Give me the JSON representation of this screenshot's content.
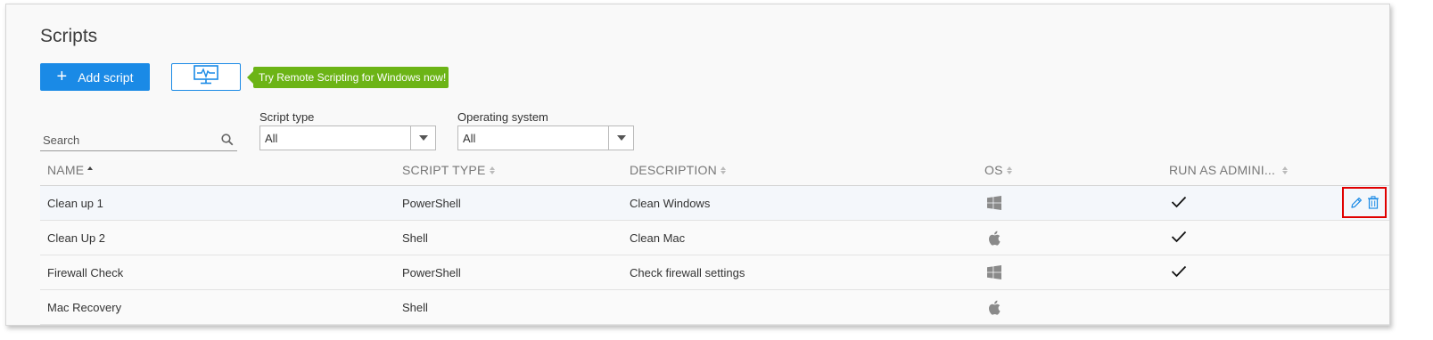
{
  "page": {
    "title": "Scripts"
  },
  "toolbar": {
    "add_label": "Add script",
    "add_icon": "plus-icon",
    "remote_icon": "monitor-pulse-icon",
    "promo_text": "Try Remote Scripting for Windows now!"
  },
  "filters": {
    "search_placeholder": "Search",
    "script_type_label": "Script type",
    "script_type_value": "All",
    "os_label": "Operating system",
    "os_value": "All"
  },
  "table": {
    "columns": [
      "NAME",
      "SCRIPT TYPE",
      "DESCRIPTION",
      "OS",
      "RUN AS ADMINI..."
    ],
    "rows": [
      {
        "name": "Clean up 1",
        "script_type": "PowerShell",
        "description": "Clean Windows",
        "os": "windows-icon",
        "run_as_admin": true
      },
      {
        "name": "Clean Up 2",
        "script_type": "Shell",
        "description": "Clean Mac",
        "os": "apple-icon",
        "run_as_admin": true
      },
      {
        "name": "Firewall Check",
        "script_type": "PowerShell",
        "description": "Check firewall settings",
        "os": "windows-icon",
        "run_as_admin": true
      },
      {
        "name": "Mac Recovery",
        "script_type": "Shell",
        "description": "",
        "os": "apple-icon",
        "run_as_admin": false
      }
    ]
  },
  "colors": {
    "primary": "#1a8ae6",
    "promo": "#6cb416",
    "highlight_border": "#e00000"
  }
}
